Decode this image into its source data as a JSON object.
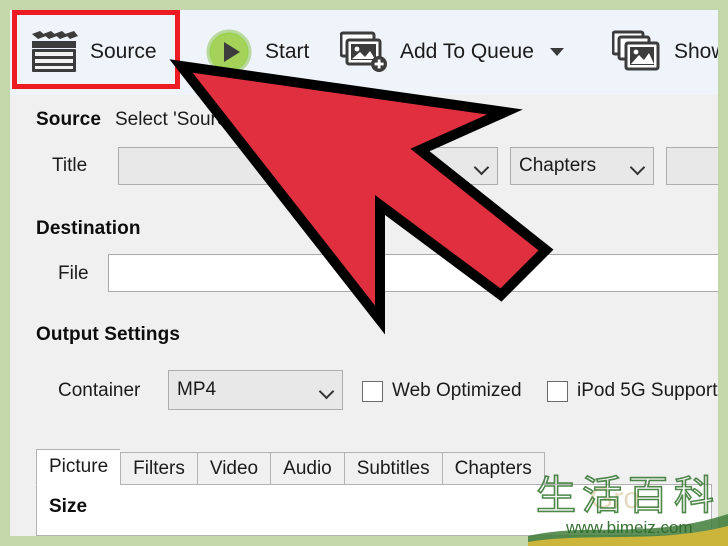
{
  "window": {
    "background_color": "#f0f0f0",
    "frame_color": "#c4d7ab"
  },
  "toolbar": {
    "background_color": "#eff3fa",
    "items": [
      {
        "id": "source",
        "label": "Source",
        "icon": "clapperboard-icon",
        "has_dropdown": false,
        "highlighted": true
      },
      {
        "id": "start",
        "label": "Start",
        "icon": "play-circle-icon",
        "has_dropdown": false,
        "highlighted": false
      },
      {
        "id": "add-to-queue",
        "label": "Add To Queue",
        "icon": "add-to-queue-icon",
        "has_dropdown": true,
        "highlighted": false
      },
      {
        "id": "show-queue",
        "label": "Show",
        "icon": "show-queue-icon",
        "has_dropdown": false,
        "highlighted": false
      }
    ],
    "highlight_color": "#ee1c22"
  },
  "source_section": {
    "title": "Source",
    "note": "Select 'Source'",
    "title_field": {
      "label": "Title",
      "value": "",
      "placeholder": ""
    },
    "chapters_field": {
      "value": "Chapters"
    },
    "range_field": {
      "value": ""
    }
  },
  "destination_section": {
    "title": "Destination",
    "file_field": {
      "label": "File",
      "value": "",
      "placeholder": ""
    }
  },
  "output_settings": {
    "title": "Output Settings",
    "container_field": {
      "label": "Container",
      "value": "MP4"
    },
    "checkboxes": [
      {
        "id": "web-optimized",
        "label": "Web Optimized",
        "checked": false
      },
      {
        "id": "ipod-5g",
        "label": "iPod 5G Support",
        "checked": false
      }
    ]
  },
  "tabs": {
    "items": [
      {
        "id": "picture",
        "label": "Picture",
        "active": true
      },
      {
        "id": "filters",
        "label": "Filters",
        "active": false
      },
      {
        "id": "video",
        "label": "Video",
        "active": false
      },
      {
        "id": "audio",
        "label": "Audio",
        "active": false
      },
      {
        "id": "subtitles",
        "label": "Subtitles",
        "active": false
      },
      {
        "id": "chapters",
        "label": "Chapters",
        "active": false
      }
    ],
    "panel": {
      "size_heading": "Size"
    }
  },
  "cursor": {
    "type": "arrow-cursor",
    "fill_color": "#e03040",
    "outline_color": "#000000",
    "points_to": "source"
  },
  "watermark": {
    "characters": "生活百科",
    "url": "www.bimeiz.com",
    "ghost_text": "Gro",
    "color": "#3f7d3a"
  }
}
